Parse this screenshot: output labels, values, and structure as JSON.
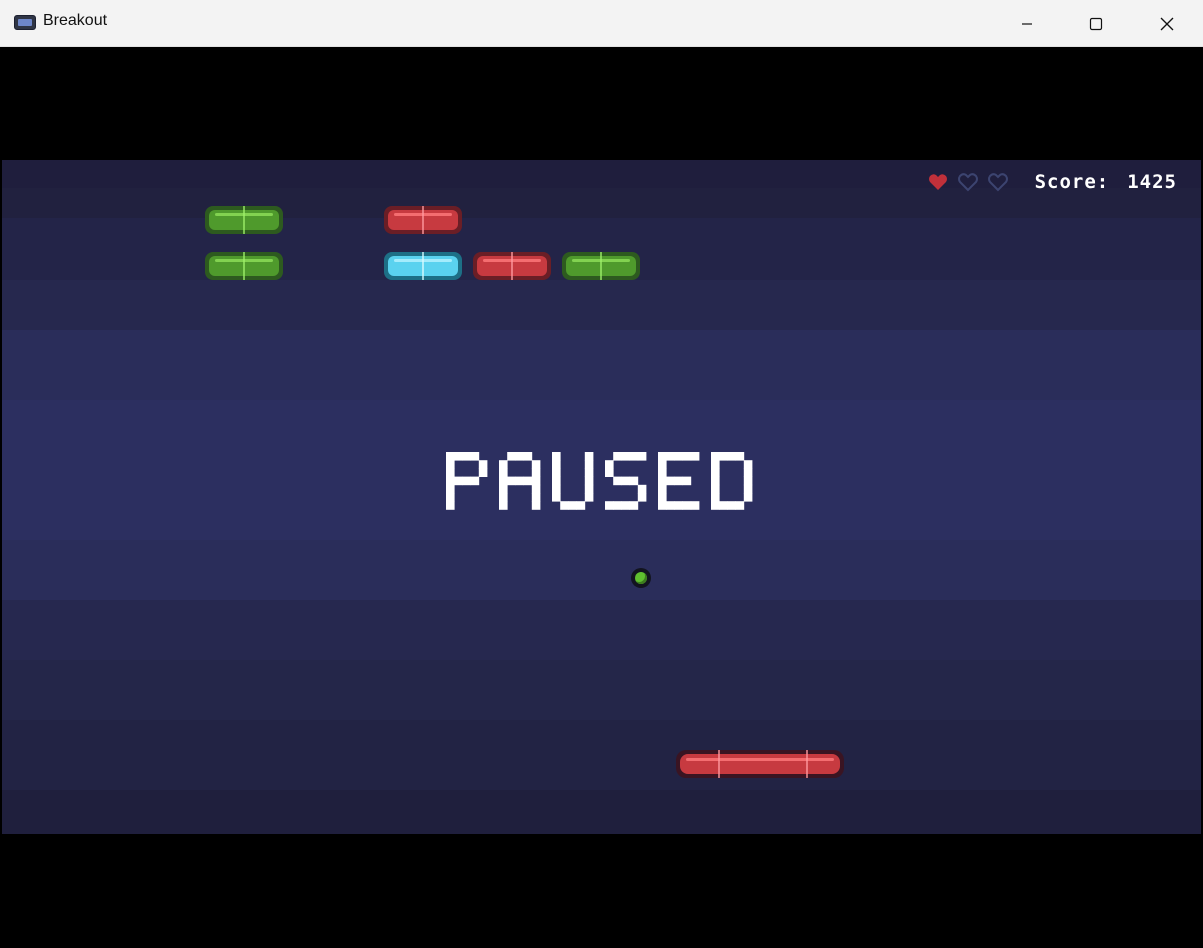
{
  "window": {
    "title": "Breakout",
    "app_icon": "breakout-app-icon"
  },
  "window_controls": {
    "minimize": "minimize-icon",
    "maximize": "maximize-icon",
    "close": "close-icon"
  },
  "hud": {
    "lives_total": 3,
    "lives_remaining": 1,
    "score_label": "Score:",
    "score_value": "1425"
  },
  "overlay": {
    "text": "PAUSED"
  },
  "bricks": [
    {
      "row": 1,
      "col": 1,
      "color": "green"
    },
    {
      "row": 1,
      "col": 3,
      "color": "red"
    },
    {
      "row": 2,
      "col": 1,
      "color": "green"
    },
    {
      "row": 2,
      "col": 3,
      "color": "cyan"
    },
    {
      "row": 2,
      "col": 4,
      "color": "red"
    },
    {
      "row": 2,
      "col": 5,
      "color": "green"
    }
  ],
  "colors": {
    "brick_green": "#4f9a2c",
    "brick_red": "#c73a40",
    "brick_cyan": "#5ad2ef",
    "ball": "#5fbf2f",
    "paddle": "#c73a40",
    "heart_full": "#c0303a",
    "heart_empty": "#3c4470",
    "background": "#2a2d5a"
  }
}
